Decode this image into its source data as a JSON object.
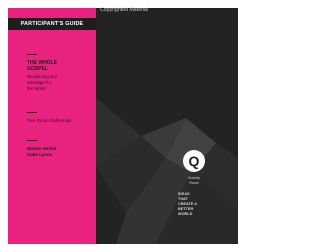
{
  "cover": {
    "label": "PARTICIPANT'S GUIDE",
    "title_line_1": "THE WHOLE",
    "title_line_2": "GOSPEL",
    "subtitle_line_1": "Reclaiming Our",
    "subtitle_line_2": "Message for",
    "subtitle_line_3": "the World",
    "small_group": "Five Group Gatherings",
    "author_1": "Norton Herbst",
    "author_2": "Gabe Lyons",
    "q_mark": "Q",
    "brand_line_1": "Society",
    "brand_line_2": "Room",
    "tagline_line_1": "IDEAS",
    "tagline_line_2": "THAT",
    "tagline_line_3": "CREATE A",
    "tagline_line_4": "BETTER",
    "tagline_line_5": "WORLD"
  },
  "watermark": "Copyrighted Material",
  "colors": {
    "pink": "#e9227f",
    "dark": "#232323",
    "ink": "#1e1e1e"
  }
}
